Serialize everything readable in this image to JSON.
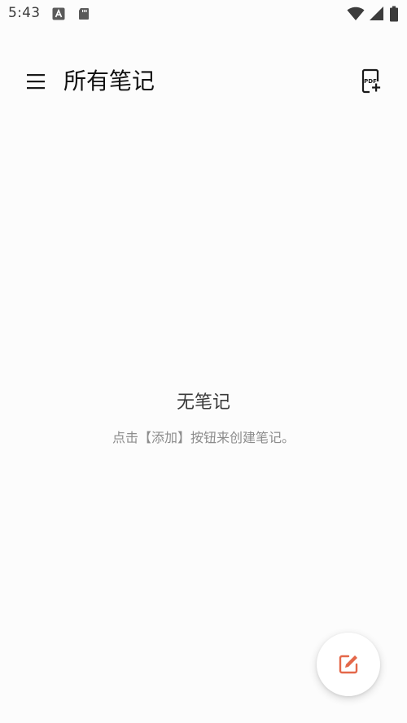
{
  "status_bar": {
    "time": "5:43"
  },
  "app_bar": {
    "title": "所有笔记"
  },
  "empty_state": {
    "title": "无笔记",
    "hint": "点击【添加】按钮来创建笔记。"
  },
  "colors": {
    "background": "#fcfcfc",
    "accent": "#e4684a",
    "title_text": "#111111",
    "hint_text": "#8c8c8c"
  },
  "icons": {
    "menu": "menu-icon",
    "pdf_add": "pdf-add-icon",
    "new_note": "edit-note-icon"
  }
}
